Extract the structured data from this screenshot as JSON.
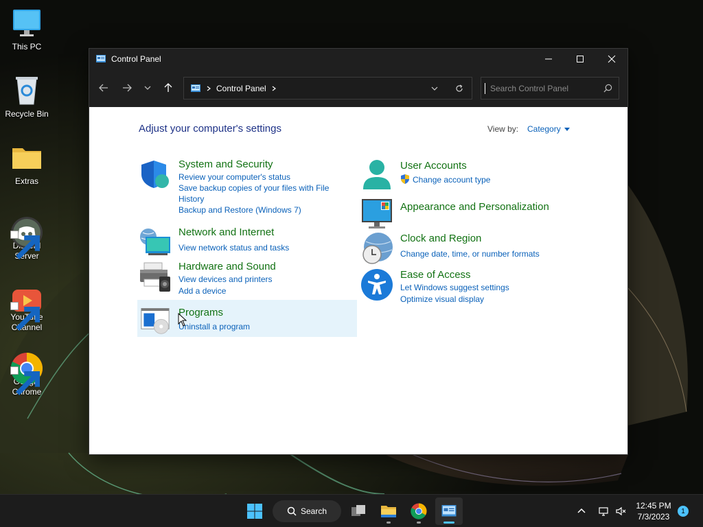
{
  "desktop": {
    "icons": [
      {
        "label": "This PC"
      },
      {
        "label": "Recycle Bin"
      },
      {
        "label": "Extras"
      },
      {
        "label": "Discord\nServer"
      },
      {
        "label": "YouTube\nChannel"
      },
      {
        "label": "Google\nChrome"
      }
    ]
  },
  "window": {
    "title": "Control Panel",
    "breadcrumb": "Control Panel",
    "search_placeholder": "Search Control Panel"
  },
  "content": {
    "heading": "Adjust your computer's settings",
    "view_by_label": "View by:",
    "view_by_value": "Category",
    "categories": [
      {
        "title": "System and Security",
        "links": [
          "Review your computer's status",
          "Save backup copies of your files with File History",
          "Backup and Restore (Windows 7)"
        ]
      },
      {
        "title": "Network and Internet",
        "links": [
          "View network status and tasks"
        ]
      },
      {
        "title": "Hardware and Sound",
        "links": [
          "View devices and printers",
          "Add a device"
        ]
      },
      {
        "title": "Programs",
        "links": [
          "Uninstall a program"
        ]
      },
      {
        "title": "User Accounts",
        "links": [
          "Change account type"
        ]
      },
      {
        "title": "Appearance and Personalization",
        "links": []
      },
      {
        "title": "Clock and Region",
        "links": [
          "Change date, time, or number formats"
        ]
      },
      {
        "title": "Ease of Access",
        "links": [
          "Let Windows suggest settings",
          "Optimize visual display"
        ]
      }
    ]
  },
  "taskbar": {
    "search_label": "Search",
    "time": "12:45 PM",
    "date": "7/3/2023",
    "notification_count": "1"
  },
  "colors": {
    "category_title": "#127213",
    "link": "#0a61b9",
    "heading": "#1e3287",
    "accent": "#4cc2ff"
  }
}
